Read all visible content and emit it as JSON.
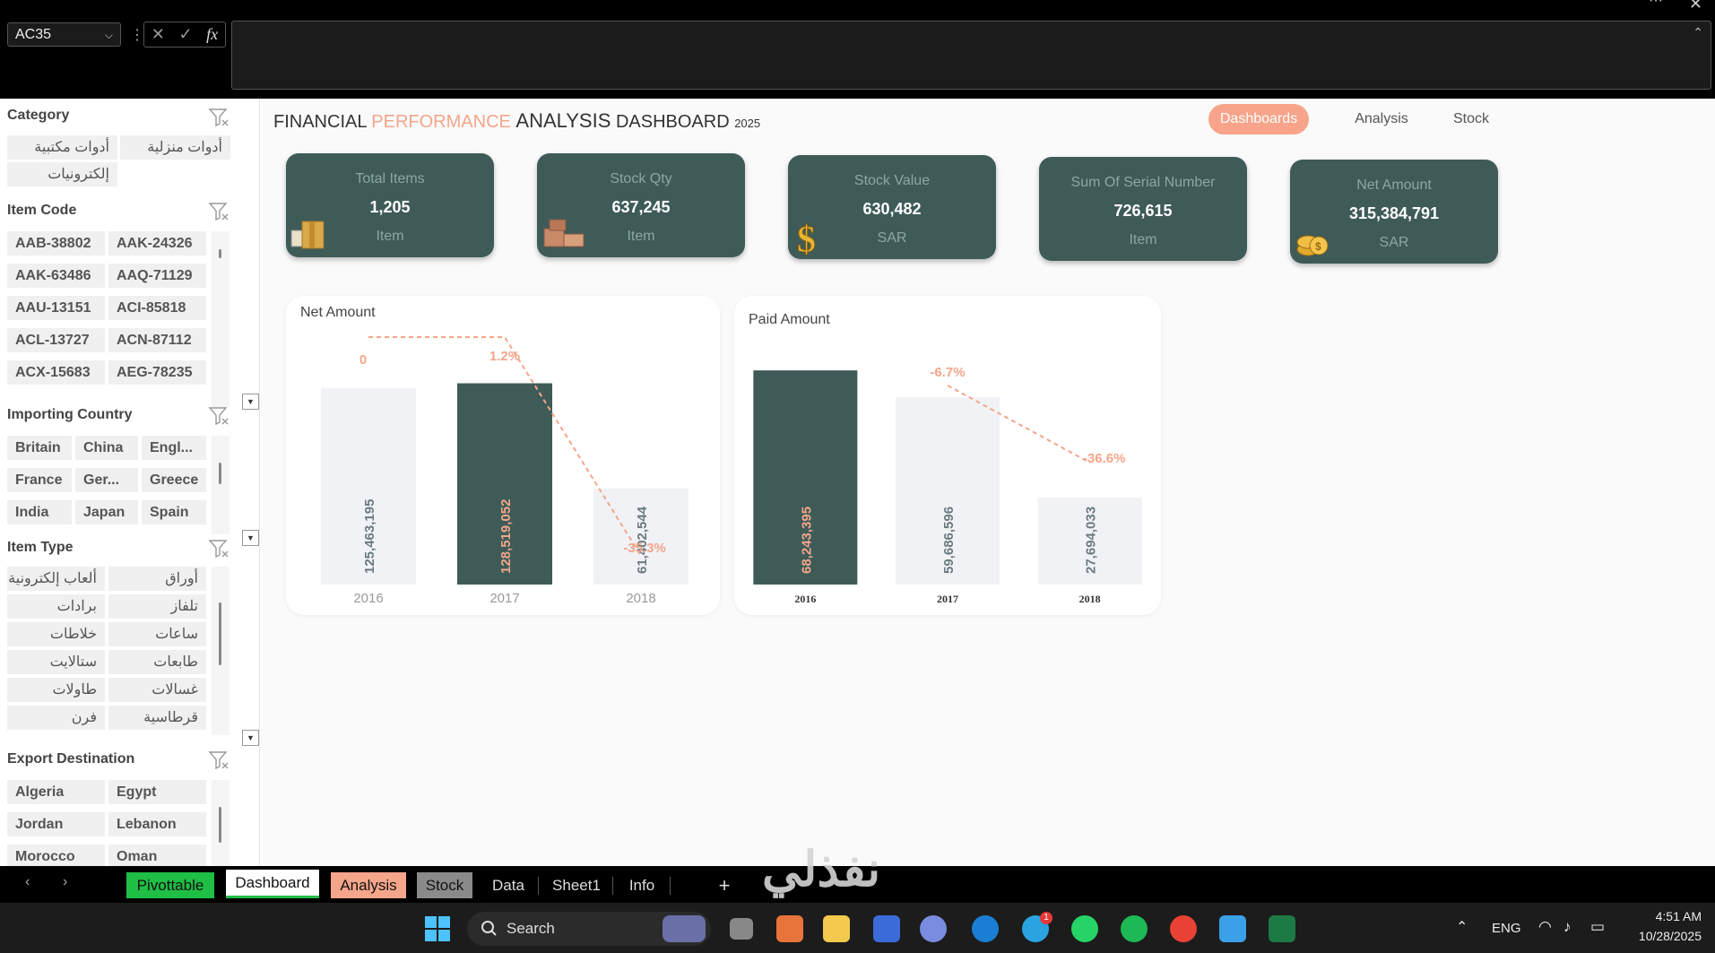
{
  "formula_bar": {
    "name_box": "AC35",
    "fx_label": "fx",
    "formula_value": ""
  },
  "slicers": {
    "category": {
      "title": "Category",
      "items": [
        "أدوات مكتبية",
        "أدوات منزلية",
        "إلكترونيات"
      ]
    },
    "item_code": {
      "title": "Item Code",
      "items": [
        "AAB-38802",
        "AAK-24326",
        "AAK-63486",
        "AAQ-71129",
        "AAU-13151",
        "ACI-85818",
        "ACL-13727",
        "ACN-87112",
        "ACX-15683",
        "AEG-78235"
      ]
    },
    "importing_country": {
      "title": "Importing Country",
      "items": [
        "Britain",
        "China",
        "Engl...",
        "France",
        "Ger...",
        "Greece",
        "India",
        "Japan",
        "Spain"
      ]
    },
    "item_type": {
      "title": "Item Type",
      "items": [
        "ألعاب إلكترونية",
        "أوراق",
        "برادات",
        "تلفاز",
        "خلاطات",
        "ساعات",
        "ستالايت",
        "طابعات",
        "طاولات",
        "غسالات",
        "فرن",
        "قرطاسية"
      ]
    },
    "export_destination": {
      "title": "Export Destination",
      "items": [
        "Algeria",
        "Egypt",
        "Jordan",
        "Lebanon",
        "Morocco",
        "Oman"
      ]
    }
  },
  "dashboard": {
    "title": {
      "part1": "FINANCIAL ",
      "part2": "PERFORMANCE ",
      "part3": "ANALYSIS",
      "part4": " DASHBOARD ",
      "year": "2025"
    },
    "nav": [
      "Dashboards",
      "Analysis",
      "Stock"
    ],
    "kpis": [
      {
        "label": "Total Items",
        "value": "1,205",
        "unit": "Item",
        "icon": "boxes-icon"
      },
      {
        "label": "Stock Qty",
        "value": "637,245",
        "unit": "Item",
        "icon": "cartons-icon"
      },
      {
        "label": "Stock  Value",
        "value": "630,482",
        "unit": "SAR",
        "icon": "dollar-icon"
      },
      {
        "label": "Sum Of Serial Number",
        "value": "726,615",
        "unit": "Item",
        "icon": ""
      },
      {
        "label": "Net Amount",
        "value": "315,384,791",
        "unit": "SAR",
        "icon": "coins-icon"
      }
    ]
  },
  "chart_data": [
    {
      "type": "bar",
      "title": "Net Amount",
      "categories": [
        "2016",
        "2017",
        "2018"
      ],
      "values": [
        125463195,
        128519052,
        61402544
      ],
      "value_labels": [
        "125,463,195",
        "128,519,052",
        "61,402,544"
      ],
      "change_labels": [
        "0",
        "1.2%",
        "-35.3%"
      ],
      "change_values": [
        0,
        1.2,
        -35.3
      ],
      "highlight_index": 1,
      "ylim": [
        0,
        150000000
      ]
    },
    {
      "type": "bar",
      "title": "Paid Amount",
      "categories": [
        "2016",
        "2017",
        "2018"
      ],
      "values": [
        68243395,
        59686596,
        27694033
      ],
      "value_labels": [
        "68,243,395",
        "59,686,596",
        "27,694,033"
      ],
      "change_labels": [
        "",
        "-6.7%",
        "-36.6%"
      ],
      "change_values": [
        null,
        -6.7,
        -36.6
      ],
      "highlight_index": 0,
      "ylim": [
        0,
        72000000
      ]
    }
  ],
  "sheet_tabs": [
    "Pivottable",
    "Dashboard",
    "Analysis",
    "Stock",
    "Data",
    "Sheet1",
    "Info"
  ],
  "add_sheet": "+",
  "watermark": "نفذلي",
  "watermark_url": "nafezly.com",
  "taskbar": {
    "search_label": "Search",
    "lang": "ENG",
    "time": "4:51 AM",
    "date": "10/28/2025",
    "telegram_badge": "1"
  },
  "colors": {
    "dark_teal": "#3e5b58",
    "salmon": "#f4a58a",
    "light_bar": "#f1f2f6"
  }
}
